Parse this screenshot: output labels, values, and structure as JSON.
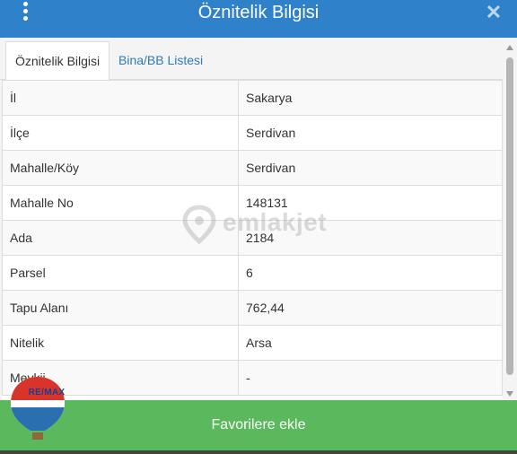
{
  "header": {
    "title": "Öznitelik Bilgisi"
  },
  "tabs": [
    {
      "label": "Öznitelik Bilgisi",
      "active": true
    },
    {
      "label": "Bina/BB Listesi",
      "active": false
    }
  ],
  "rows": [
    {
      "key": "İl",
      "value": "Sakarya"
    },
    {
      "key": "İlçe",
      "value": "Serdivan"
    },
    {
      "key": "Mahalle/Köy",
      "value": "Serdivan"
    },
    {
      "key": "Mahalle No",
      "value": "148131"
    },
    {
      "key": "Ada",
      "value": "2184"
    },
    {
      "key": "Parsel",
      "value": "6"
    },
    {
      "key": "Tapu Alanı",
      "value": "762,44"
    },
    {
      "key": "Nitelik",
      "value": "Arsa"
    },
    {
      "key": "Mevkii",
      "value": "-"
    }
  ],
  "footer": {
    "button_label": "Favorilere ekle"
  },
  "watermark": {
    "text": "emlakjet"
  },
  "logo": {
    "text": "RE/MAX"
  },
  "colors": {
    "header": "#2f82c9",
    "footer": "#5cb85c",
    "tab_link": "#2f7ab8"
  },
  "icons": [
    "kebab-menu-icon",
    "close-icon",
    "location-pin-icon",
    "balloon-logo-icon"
  ]
}
